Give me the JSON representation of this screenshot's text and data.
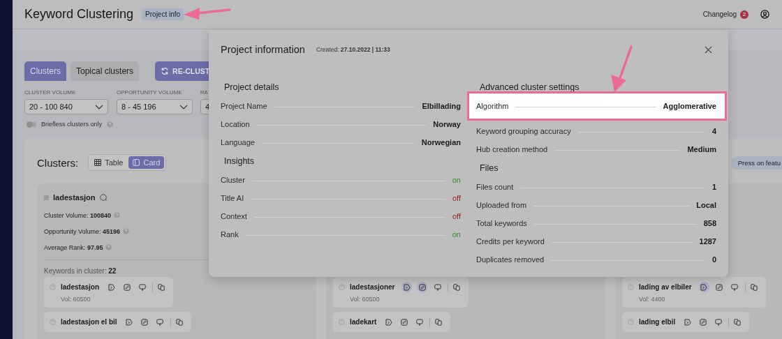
{
  "header": {
    "title": "Keyword Clustering",
    "project_info": "Project info",
    "changelog": "Changelog",
    "changelog_count": "2"
  },
  "tabs": [
    {
      "label": "Clusters",
      "selected": true
    },
    {
      "label": "Topical clusters",
      "selected": false
    }
  ],
  "recluster_button": "RE-CLUST",
  "filters": [
    {
      "label": "CLUSTER VOLUME",
      "value": "20 - 100 840"
    },
    {
      "label": "OPPORTUNITY VOLUME",
      "value": "8 - 45 196"
    },
    {
      "label": "RA",
      "value": "4"
    }
  ],
  "briefless_toggle": {
    "label": "Briefless clusters only",
    "on": false
  },
  "clusters_panel": {
    "title": "Clusters:",
    "views": [
      {
        "label": "Table",
        "selected": false
      },
      {
        "label": "Card",
        "selected": true
      }
    ],
    "hint": "Press on featu"
  },
  "cards": [
    {
      "title": "ladestasjon",
      "checked": false,
      "stats": [
        {
          "label": "Cluster Volume:",
          "value": "100840"
        },
        {
          "label": "Opportunity Volume:",
          "value": "45196"
        },
        {
          "label": "Average Rank:",
          "value": "97.95"
        }
      ],
      "keywords_label": "Keywords in cluster:",
      "keywords_count": "22",
      "keywords": [
        {
          "name": "ladestasjon",
          "volume": "Vol: 60500",
          "brief": false,
          "edit": false,
          "serp": false
        },
        {
          "name": "ladestasjon el bil",
          "brief": false,
          "edit": false,
          "serp": false
        }
      ]
    },
    {
      "keywords": [
        {
          "name": "ladestasjoner",
          "volume": "Vol: 60500",
          "brief": true,
          "edit": true,
          "serp": false
        },
        {
          "name": "ladekart",
          "brief": false,
          "edit": false,
          "serp": false
        }
      ]
    },
    {
      "keywords": [
        {
          "name": "lading av elbiler",
          "volume": "Vol: 4400",
          "brief": true,
          "edit": false,
          "serp": false
        },
        {
          "name": "lading elbil",
          "brief": false,
          "edit": false,
          "serp": false
        }
      ]
    }
  ],
  "modal": {
    "title": "Project information",
    "created": "Created: **27.10.2022 | 11:33**",
    "columns": [
      {
        "sections": [
          {
            "title": "Project details",
            "rows": [
              {
                "label": "Project Name",
                "value": "Elbillading",
                "highlighted": false
              },
              {
                "label": "Location",
                "value": "Norway",
                "highlighted": false
              },
              {
                "label": "Language",
                "value": "Norwegian",
                "highlighted": false
              }
            ]
          },
          {
            "title": "Insights",
            "rows": [
              {
                "label": "Cluster",
                "value": "on",
                "enabled": true,
                "highlighted": false
              },
              {
                "label": "Title AI",
                "value": "off",
                "enabled": false,
                "highlighted": false
              },
              {
                "label": "Context",
                "value": "off",
                "enabled": false,
                "highlighted": false
              },
              {
                "label": "Rank",
                "value": "on",
                "enabled": true,
                "highlighted": false
              }
            ]
          }
        ]
      },
      {
        "sections": [
          {
            "title": "Advanced cluster settings",
            "rows": [
              {
                "label": "Algorithm",
                "value": "Agglomerative",
                "highlighted": true
              },
              {
                "label": "Keyword grouping accuracy",
                "value": "4",
                "highlighted": false
              },
              {
                "label": "Hub creation method",
                "value": "Medium",
                "highlighted": false
              }
            ]
          },
          {
            "title": "Files",
            "rows": [
              {
                "label": "Files count",
                "value": "1",
                "highlighted": false
              },
              {
                "label": "Uploaded from",
                "value": "Local",
                "highlighted": false
              },
              {
                "label": "Total keywords",
                "value": "858",
                "highlighted": false
              },
              {
                "label": "Credits per keyword",
                "value": "1287",
                "highlighted": false
              },
              {
                "label": "Duplicates removed",
                "value": "0",
                "highlighted": false
              }
            ]
          }
        ]
      }
    ]
  }
}
